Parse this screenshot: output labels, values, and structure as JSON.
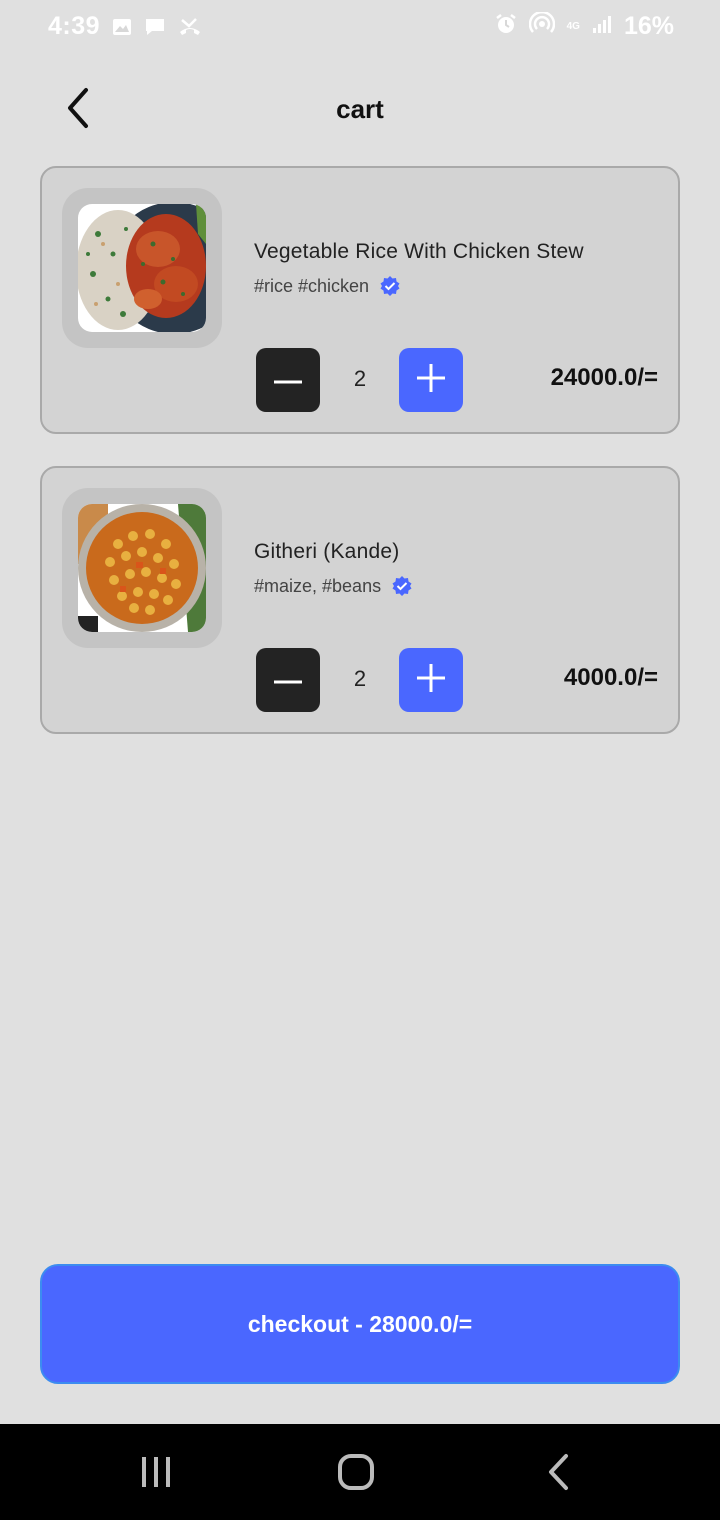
{
  "status_bar": {
    "time": "4:39",
    "network": "4G",
    "battery": "16%",
    "left_icons": [
      "image-icon",
      "message-icon",
      "missed-call-icon"
    ],
    "right_icons": [
      "alarm-icon",
      "hotspot-icon",
      "signal-icon",
      "battery-icon"
    ]
  },
  "header": {
    "title": "cart",
    "back_icon": "chevron-left-icon"
  },
  "cart": {
    "items": [
      {
        "name": "Vegetable Rice With Chicken Stew",
        "tags": "#rice #chicken",
        "quantity": "2",
        "price": "24000.0/=",
        "image": "rice-chicken-stew-photo"
      },
      {
        "name": "Githeri (Kande)",
        "tags": "#maize, #beans",
        "quantity": "2",
        "price": "4000.0/=",
        "image": "githeri-photo"
      }
    ]
  },
  "checkout": {
    "label": "checkout - 28000.0/="
  },
  "colors": {
    "accent": "#4a67ff",
    "background": "#e0e0e0",
    "card": "#d3d3d3",
    "dark_button": "#232323",
    "verified": "#4a67ff"
  },
  "nav": {
    "icons": [
      "recent-apps-icon",
      "home-icon",
      "back-icon"
    ]
  }
}
